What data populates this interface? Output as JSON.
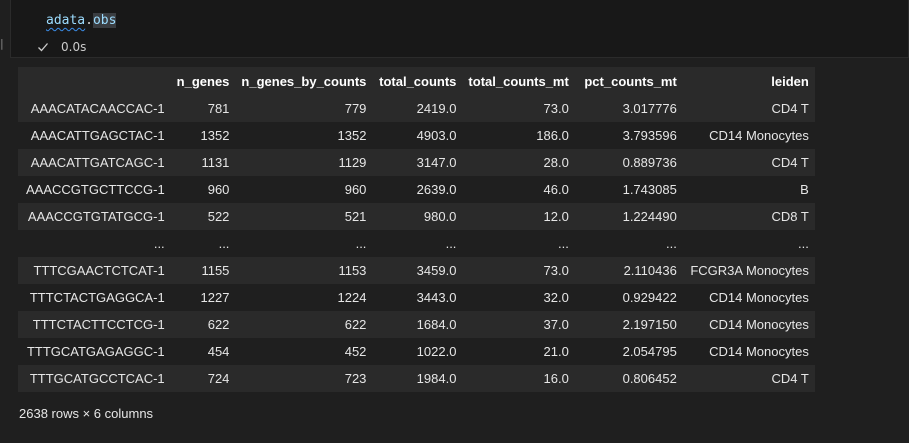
{
  "cell": {
    "code_var": "adata",
    "code_dot": ".",
    "code_attr": "obs",
    "exec_time": "0.0s",
    "gutter_char": "|"
  },
  "table": {
    "columns": [
      "",
      "n_genes",
      "n_genes_by_counts",
      "total_counts",
      "total_counts_mt",
      "pct_counts_mt",
      "leiden"
    ],
    "rows": [
      [
        "AAACATACAACCAC-1",
        "781",
        "779",
        "2419.0",
        "73.0",
        "3.017776",
        "CD4 T"
      ],
      [
        "AAACATTGAGCTAC-1",
        "1352",
        "1352",
        "4903.0",
        "186.0",
        "3.793596",
        "CD14 Monocytes"
      ],
      [
        "AAACATTGATCAGC-1",
        "1131",
        "1129",
        "3147.0",
        "28.0",
        "0.889736",
        "CD4 T"
      ],
      [
        "AAACCGTGCTTCCG-1",
        "960",
        "960",
        "2639.0",
        "46.0",
        "1.743085",
        "B"
      ],
      [
        "AAACCGTGTATGCG-1",
        "522",
        "521",
        "980.0",
        "12.0",
        "1.224490",
        "CD8 T"
      ],
      [
        "...",
        "...",
        "...",
        "...",
        "...",
        "...",
        "..."
      ],
      [
        "TTTCGAACTCTCAT-1",
        "1155",
        "1153",
        "3459.0",
        "73.0",
        "2.110436",
        "FCGR3A Monocytes"
      ],
      [
        "TTTCTACTGAGGCA-1",
        "1227",
        "1224",
        "3443.0",
        "32.0",
        "0.929422",
        "CD14 Monocytes"
      ],
      [
        "TTTCTACTTCCTCG-1",
        "622",
        "622",
        "1684.0",
        "37.0",
        "2.197150",
        "CD14 Monocytes"
      ],
      [
        "TTTGCATGAGAGGC-1",
        "454",
        "452",
        "1022.0",
        "21.0",
        "2.054795",
        "CD14 Monocytes"
      ],
      [
        "TTTGCATGCCTCAC-1",
        "724",
        "723",
        "1984.0",
        "16.0",
        "0.806452",
        "CD4 T"
      ]
    ],
    "summary": "2638 rows × 6 columns"
  },
  "icons": {
    "status": "check-icon"
  },
  "colors": {
    "background": "#1f1f1f",
    "row_stripe": "#2a2a2a",
    "code_identifier": "#9cdcfe"
  }
}
